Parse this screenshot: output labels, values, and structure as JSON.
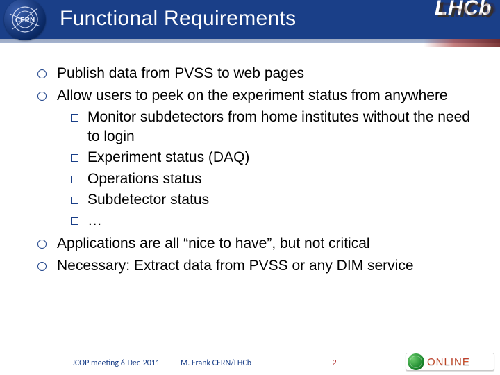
{
  "header": {
    "title": "Functional Requirements",
    "cern_label": "CERN",
    "lhcb_label": "LHCb"
  },
  "bullets": {
    "items": [
      {
        "text": "Publish data from PVSS to web pages"
      },
      {
        "text": "Allow users to peek on the experiment status from anywhere",
        "children": [
          "Monitor subdetectors from home institutes without the need to login",
          "Experiment status (DAQ)",
          "Operations status",
          "Subdetector status",
          "…"
        ]
      },
      {
        "text": "Applications are all “nice to have”, but not critical"
      },
      {
        "text": "Necessary: Extract data from PVSS or any DIM service"
      }
    ]
  },
  "footer": {
    "event": "JCOP meeting 6-Dec-2011",
    "author": "M. Frank CERN/LHCb",
    "page": "2",
    "badge": "ONLINE"
  }
}
